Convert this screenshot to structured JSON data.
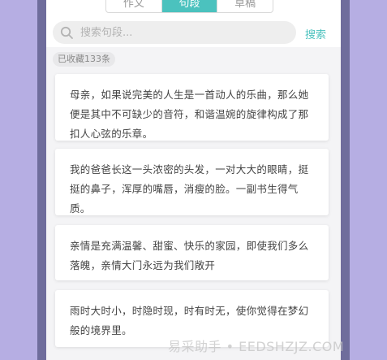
{
  "tabs": [
    {
      "label": "作文",
      "active": false
    },
    {
      "label": "句段",
      "active": true
    },
    {
      "label": "草稿",
      "active": false
    }
  ],
  "search": {
    "placeholder": "搜索句段...",
    "value": "",
    "button_label": "搜索"
  },
  "collection": {
    "count_label": "已收藏133条"
  },
  "quotes": [
    {
      "text": "母亲，如果说完美的人生是一首动人的乐曲，那么她便是其中不可缺少的音符，和谐温婉的旋律构成了那扣人心弦的乐章。"
    },
    {
      "text": "我的爸爸长这一头浓密的头发，一对大大的眼睛，挺挺的鼻子，浑厚的嘴唇，消瘦的脸。一副书生得气质。"
    },
    {
      "text": "亲情是充满温馨、甜蜜、快乐的家园，即使我们多么落魄，亲情大门永远为我们敞开"
    },
    {
      "text": "雨时大时小，时隐时现，时有时无，使你觉得在梦幻般的境界里。"
    }
  ],
  "watermark": "易采助手 • EEDSHZJZ.COM",
  "colors": {
    "accent": "#4bc2be",
    "background": "#b6aee3",
    "frame": "#6f6d9c"
  },
  "icons": {
    "search": "search-icon"
  }
}
